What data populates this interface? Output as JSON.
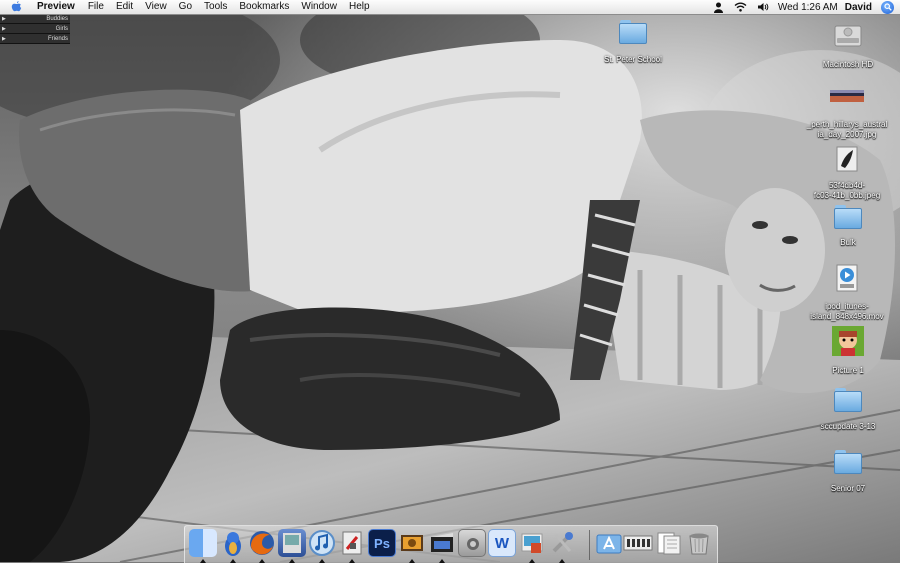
{
  "menubar": {
    "apple_icon": "apple-logo-icon",
    "app_name": "Preview",
    "menus": [
      "File",
      "Edit",
      "View",
      "Go",
      "Tools",
      "Bookmarks",
      "Window",
      "Help"
    ],
    "status_icons": [
      "script-icon",
      "wifi-icon",
      "volume-icon"
    ],
    "clock": "Wed 1:26 AM",
    "user": "David",
    "spotlight_icon": "spotlight-icon"
  },
  "buddy_list": {
    "groups": [
      "Buddies",
      "Girls",
      "Friends"
    ]
  },
  "desktop_icons": [
    {
      "label": "St. Peter School",
      "icon": "folder-icon"
    },
    {
      "label": "Macintosh HD",
      "icon": "hard-drive-icon"
    },
    {
      "label": "_perth_hillarys_austral",
      "label2": "ia_day_2007.jpg",
      "icon": "image-file-icon"
    },
    {
      "label": "53f4db4d-",
      "label2": "fc03-41b_0bb.jpeg",
      "icon": "image-file-icon"
    },
    {
      "label": "Bulk",
      "icon": "folder-icon"
    },
    {
      "label": "ipod_itunes-",
      "label2": "island_848x496.mov",
      "icon": "movie-file-icon"
    },
    {
      "label": "Picture 1",
      "icon": "image-file-icon"
    },
    {
      "label": "sccupdate 3-13",
      "icon": "folder-icon"
    },
    {
      "label": "Senior 07",
      "icon": "folder-icon"
    }
  ],
  "dock": {
    "apps": [
      "finder-icon",
      "adium-icon",
      "firefox-icon",
      "preview-icon",
      "itunes-icon",
      "script-editor-icon",
      "photoshop-icon",
      "photo-app-icon",
      "final-cut-icon",
      "system-prefs-icon",
      "word-icon",
      "iphoto-icon",
      "utility-icon"
    ],
    "photoshop_label": "Ps",
    "word_label": "W",
    "right": [
      "applications-stack-icon",
      "web-clip-icon",
      "documents-stack-icon",
      "trash-icon"
    ]
  },
  "colors": {
    "menubar_top": "#fdfdfd",
    "menubar_bottom": "#e4e4e4",
    "folder_blue": "#6aaae0",
    "spotlight_blue": "#1c5fd6"
  }
}
